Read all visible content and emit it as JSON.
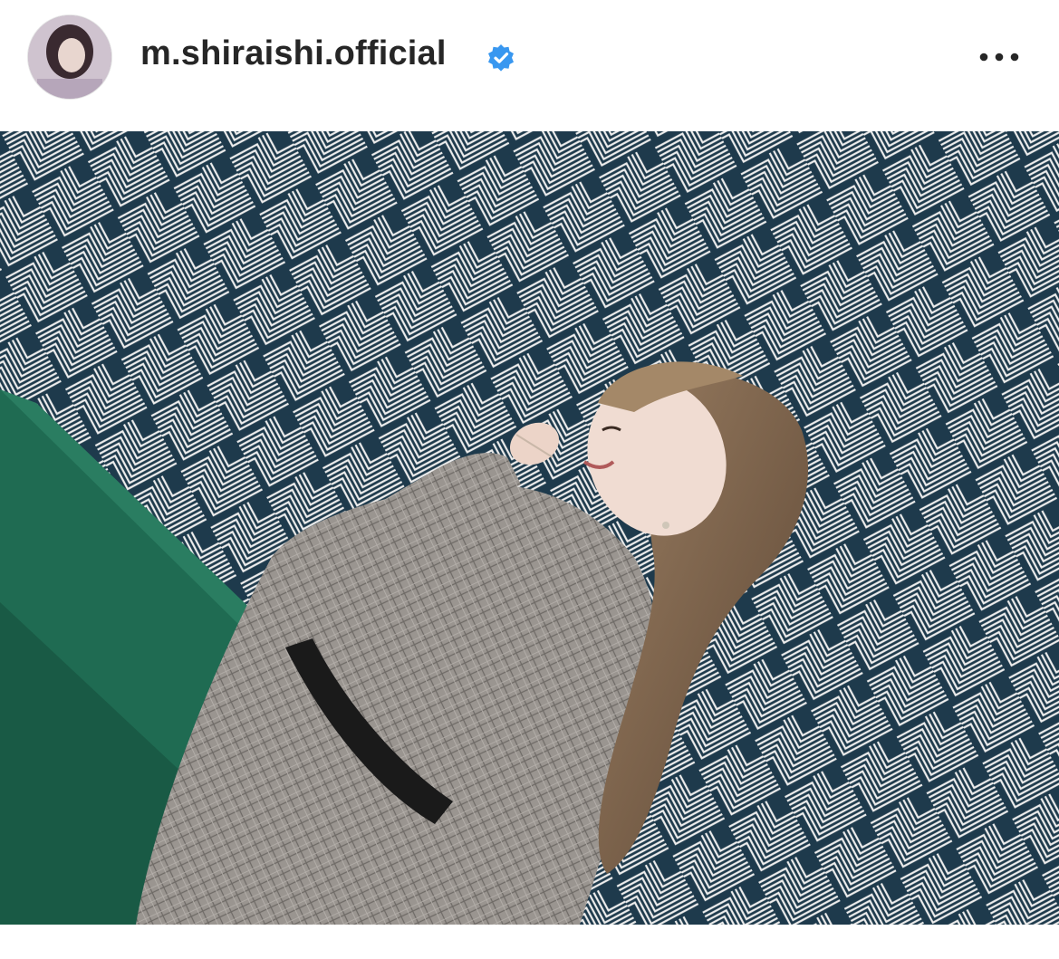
{
  "post": {
    "username": "m.shiraishi.official",
    "verified": true,
    "avatar": "profile-photo",
    "menu_icon": "more-horizontal-icon",
    "image": "photo-woman-by-geometric-wall"
  },
  "colors": {
    "text": "#262626",
    "verified_badge": "#3897f0",
    "wall_navy": "#1e3a4c",
    "sofa_green": "#1f6b52"
  }
}
